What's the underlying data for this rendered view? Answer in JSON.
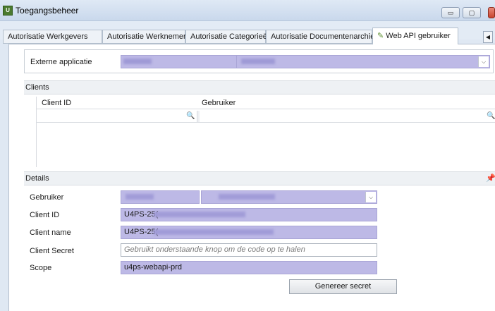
{
  "window": {
    "title": "Toegangsbeheer",
    "icon": "app-icon"
  },
  "tabs": [
    {
      "label": "Autorisatie Werkgevers"
    },
    {
      "label": "Autorisatie Werknemers"
    },
    {
      "label": "Autorisatie Categorieën"
    },
    {
      "label": "Autorisatie Documentenarchief"
    },
    {
      "label": "Web API gebruiker",
      "icon": "edit-icon",
      "active": true
    }
  ],
  "external_app": {
    "label": "Externe applicatie"
  },
  "clients": {
    "title": "Clients",
    "columns": [
      "Client ID",
      "Gebruiker"
    ]
  },
  "details": {
    "title": "Details",
    "fields": {
      "gebruiker": {
        "label": "Gebruiker"
      },
      "client_id": {
        "label": "Client ID",
        "value": "U4PS-25("
      },
      "client_name": {
        "label": "Client name",
        "value": "U4PS-25("
      },
      "client_secret": {
        "label": "Client Secret",
        "placeholder": "Gebruikt onderstaande knop om de code op te halen"
      },
      "scope": {
        "label": "Scope",
        "value": "u4ps-webapi-prd"
      }
    },
    "generate_button": "Genereer secret"
  },
  "colors": {
    "field_highlight": "#bdb9e6",
    "window_bg": "#dfe8f3"
  }
}
